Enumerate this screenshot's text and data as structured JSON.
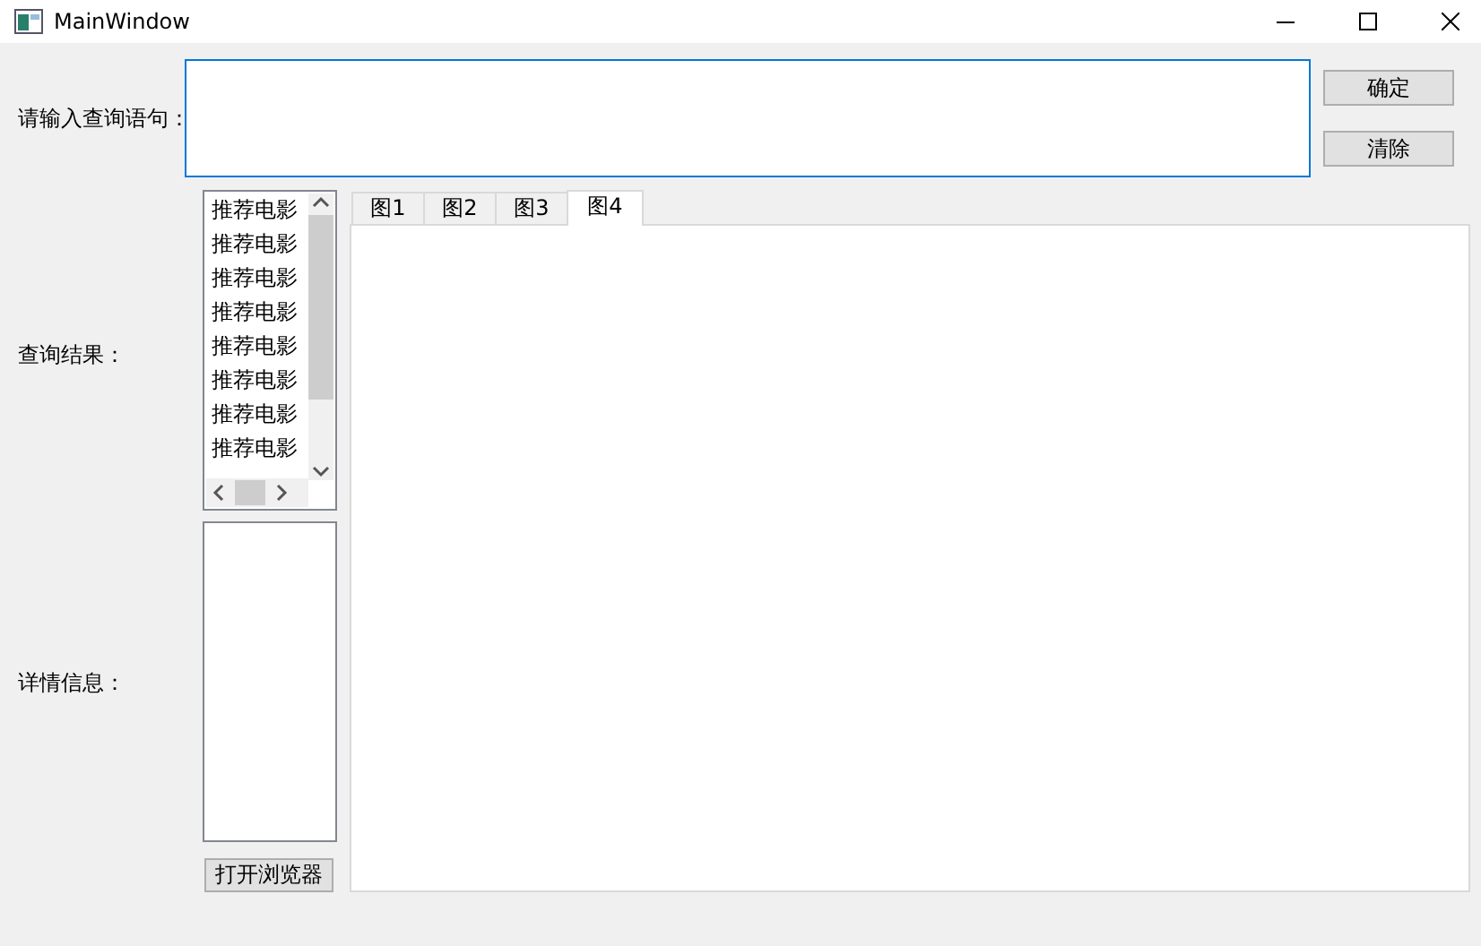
{
  "window": {
    "title": "MainWindow"
  },
  "query": {
    "label": "请输入查询语句："
  },
  "buttons": [
    {
      "label": "确定"
    },
    {
      "label": "清除"
    }
  ],
  "results": {
    "label": "查询结果：",
    "items": [
      {
        "text": "推荐电影"
      },
      {
        "text": "推荐电影"
      },
      {
        "text": "推荐电影"
      },
      {
        "text": "推荐电影"
      },
      {
        "text": "推荐电影"
      },
      {
        "text": "推荐电影"
      },
      {
        "text": "推荐电影"
      },
      {
        "text": "推荐电影"
      }
    ]
  },
  "details": {
    "label": "详情信息：",
    "button": "打开浏览器"
  },
  "tabs": [
    {
      "label": "图1",
      "selected": false
    },
    {
      "label": "图2",
      "selected": false
    },
    {
      "label": "图3",
      "selected": false
    },
    {
      "label": "图4",
      "selected": true
    }
  ]
}
